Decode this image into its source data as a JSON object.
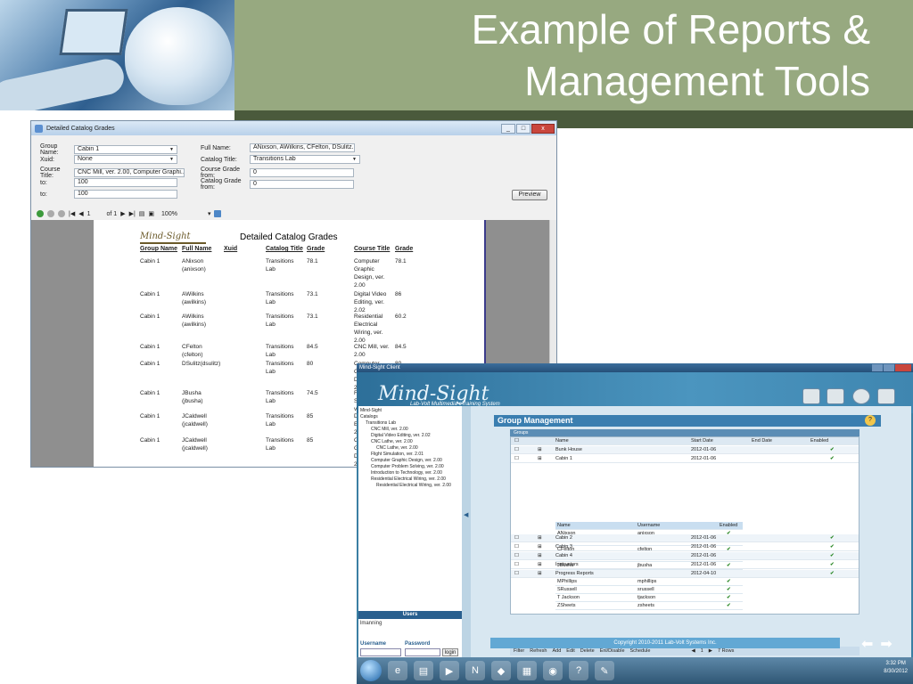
{
  "slide": {
    "title_line1": "Example of Reports &",
    "title_line2": "Management Tools"
  },
  "window1": {
    "title": "Detailed Catalog Grades",
    "controls": [
      "_",
      "□",
      "x"
    ],
    "form": {
      "group_name_label": "Group Name:",
      "group_name_value": "Cabin 1",
      "xuid_label": "Xuid:",
      "xuid_value": "None",
      "course_title_label": "Course Title:",
      "course_title_value": "CNC Mill, ver. 2.00, Computer Graphi...",
      "to_label_1": "to:",
      "to_value_1": "100",
      "to_label_2": "to:",
      "to_value_2": "100",
      "full_name_label": "Full Name:",
      "full_name_value": "ANixson, AWilkins, CFelton, DSulitz...",
      "catalog_title_label": "Catalog Title:",
      "catalog_title_value": "Transitions Lab",
      "course_grade_from_label": "Course Grade from:",
      "course_grade_from_value": "0",
      "catalog_grade_from_label": "Catalog Grade from:",
      "catalog_grade_from_value": "0",
      "preview_label": "Preview"
    },
    "toolbar": {
      "page_current": "1",
      "page_of": "of 1",
      "zoom": "100%"
    },
    "report": {
      "logo_text": "Mind-Sight",
      "title": "Detailed Catalog Grades",
      "headers": [
        "Group Name",
        "Full Name",
        "Xuid",
        "Catalog Title",
        "Grade",
        "Course Title",
        "Grade"
      ],
      "rows": [
        {
          "group": "Cabin 1",
          "name": "ANixson\n(anixson)",
          "catalog": "Transitions\nLab",
          "grade": "78.1",
          "course": "Computer\nGraphic\nDesign, ver.\n2.00",
          "course_grade": "78.1"
        },
        {
          "group": "Cabin 1",
          "name": "AWilkins\n(awilkins)",
          "catalog": "Transitions\nLab",
          "grade": "73.1",
          "course": "Digital Video\nEditing, ver.\n2.02",
          "course_grade": "86"
        },
        {
          "group": "Cabin 1",
          "name": "AWilkins\n(awilkins)",
          "catalog": "Transitions\nLab",
          "grade": "73.1",
          "course": "Residential\nElectrical\nWiring, ver.\n2.00",
          "course_grade": "60.2"
        },
        {
          "group": "Cabin 1",
          "name": "CFelton\n(cfelton)",
          "catalog": "Transitions\nLab",
          "grade": "84.5",
          "course": "CNC Mill, ver.\n2.00",
          "course_grade": "84.5"
        },
        {
          "group": "Cabin 1",
          "name": "DSulitz(dsulitz)",
          "catalog": "Transitions\nLab",
          "grade": "80",
          "course": "Computer\nG\nD\n2",
          "course_grade": "80"
        },
        {
          "group": "Cabin 1",
          "name": "JBusha\n(jbusha)",
          "catalog": "Transitions\nLab",
          "grade": "74.5",
          "course": "Fl\nS\nve",
          "course_grade": ""
        },
        {
          "group": "Cabin 1",
          "name": "JCaldwell\n(jcaldwell)",
          "catalog": "Transitions\nLab",
          "grade": "85",
          "course": "D\nE\n2.",
          "course_grade": ""
        },
        {
          "group": "Cabin 1",
          "name": "JCaldwell\n(jcaldwell)",
          "catalog": "Transitions\nLab",
          "grade": "85",
          "course": "C\nG\nD\n2.",
          "course_grade": ""
        }
      ]
    }
  },
  "window2": {
    "title": "Mind-Sight Client",
    "logo_text": "Mind-Sight",
    "tagline": "Lab-Volt Multimedia eTraining System",
    "tree": [
      "Mind-Sight",
      "Catalogs",
      "Transitions Lab",
      "CNC Mill, ver. 2.00",
      "Digital Video Editing, ver. 2.02",
      "CNC Lathe, ver. 2.00",
      "CNC Lathe, ver. 2.00",
      "Flight Simulation, ver. 2.01",
      "Computer Graphic Design, ver. 2.00",
      "Computer Problem Solving, ver. 2.00",
      "Introduction to Technology, ver. 2.00",
      "Residential Electrical Wiring, ver. 2.00",
      "Residential Electrical Wiring, ver. 2.00"
    ],
    "users_header": "Users",
    "user_item": "lmanning",
    "username_label": "Username",
    "password_label": "Password",
    "login_label": "login",
    "group_management_title": "Group Management",
    "groups_label": "Groups",
    "grid_headers": [
      "Name",
      "Start Date",
      "End Date",
      "Enabled"
    ],
    "groups_top": [
      {
        "name": "Bunk House",
        "start": "2012-01-06"
      },
      {
        "name": "Cabin 1",
        "start": "2012-01-06"
      }
    ],
    "sub_headers": [
      "Name",
      "Username",
      "Enabled"
    ],
    "members": [
      {
        "name": "ANixson",
        "username": "anixson"
      },
      {
        "name": "AWilkins",
        "username": "awilkins"
      },
      {
        "name": "CFelton",
        "username": "cfelton"
      },
      {
        "name": "DSulitz",
        "username": "dsulitz"
      },
      {
        "name": "JBusha",
        "username": "jbusha"
      },
      {
        "name": "JCaldwell",
        "username": "jcaldwell"
      },
      {
        "name": "MPhillips",
        "username": "mphillips"
      },
      {
        "name": "SRussell",
        "username": "srussell"
      },
      {
        "name": "T Jackson",
        "username": "tjackson"
      },
      {
        "name": "ZSheets",
        "username": "zsheets"
      }
    ],
    "groups_bottom": [
      {
        "name": "Cabin 2",
        "start": "2012-01-06"
      },
      {
        "name": "Cabin 3",
        "start": "2012-01-06"
      },
      {
        "name": "Cabin 4",
        "start": "2012-01-06"
      },
      {
        "name": "Instructors",
        "start": "2012-01-06"
      },
      {
        "name": "Progress Reports",
        "start": "2012-04-10"
      }
    ],
    "footer": {
      "filter": "Filter",
      "refresh": "Refresh",
      "add": "Add",
      "edit": "Edit",
      "delete": "Delete",
      "enable": "Enl/Disable",
      "schedule": "Schedule",
      "page": "1",
      "rows": "7 Rows"
    },
    "copyright": "Copyright 2010-2011 Lab-Volt Systems Inc."
  },
  "taskbar": {
    "time": "3:32 PM",
    "date": "8/30/2012"
  }
}
